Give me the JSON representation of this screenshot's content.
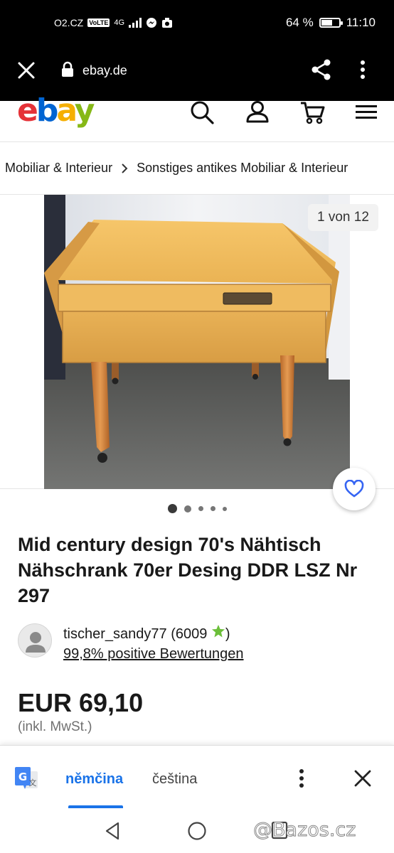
{
  "status_bar": {
    "carrier": "O2.CZ",
    "volte": "VoLTE",
    "network": "4G",
    "battery_percent": "64 %",
    "battery_level": 0.64,
    "time": "11:10"
  },
  "browser": {
    "url": "ebay.de"
  },
  "site": {
    "logo": [
      "e",
      "b",
      "a",
      "y"
    ]
  },
  "breadcrumb": {
    "items": [
      "Mobiliar & Interieur",
      "Sonstiges antikes Mobiliar & Interieur"
    ]
  },
  "gallery": {
    "counter": "1 von 12",
    "image_count": 12,
    "current_index": 1
  },
  "listing": {
    "title": "Mid century design 70's Nähtisch Nähschrank 70er Desing DDR LSZ Nr 297",
    "seller_name": "tischer_sandy77 (6009",
    "seller_name_close": ")",
    "seller_feedback": "99,8% positive Bewertungen",
    "price": "EUR 69,10",
    "vat_note": "(inkl. MwSt.)"
  },
  "translate_bar": {
    "source_lang": "němčina",
    "target_lang": "čeština"
  },
  "watermark": "@Bazos.cz",
  "colors": {
    "ebay_red": "#e53238",
    "ebay_blue": "#0064d2",
    "ebay_yellow": "#f5af02",
    "ebay_green": "#86b817",
    "translate_blue": "#1a73e8",
    "fav_blue": "#3665f3"
  },
  "icons": {
    "header": [
      "search-icon",
      "user-icon",
      "cart-icon",
      "hamburger-icon"
    ],
    "browser": [
      "close-icon",
      "lock-icon",
      "share-icon",
      "more-vert-icon"
    ],
    "nav": [
      "back-icon",
      "home-icon",
      "recents-icon"
    ]
  }
}
